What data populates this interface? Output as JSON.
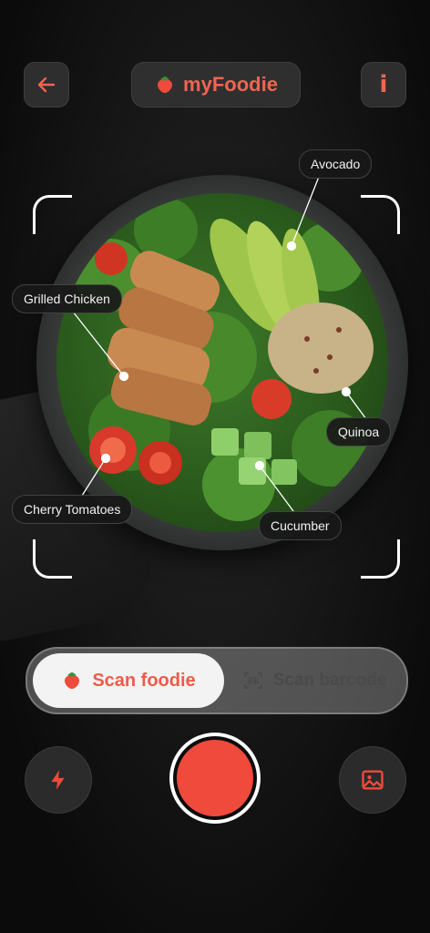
{
  "app": {
    "name": "myFoodie"
  },
  "header": {
    "back_icon": "arrow-left-icon",
    "logo_icon": "strawberry-icon",
    "info_label": "i"
  },
  "detections": [
    {
      "label": "Avocado"
    },
    {
      "label": "Grilled Chicken"
    },
    {
      "label": "Quinoa"
    },
    {
      "label": "Cherry Tomatoes"
    },
    {
      "label": "Cucumber"
    }
  ],
  "scan_modes": {
    "active": {
      "label": "Scan foodie",
      "icon": "strawberry-icon"
    },
    "other": {
      "label": "Scan barcode",
      "icon": "barcode-icon"
    }
  },
  "controls": {
    "flash_icon": "lightning-icon",
    "shutter": "capture-button",
    "gallery_icon": "image-icon"
  },
  "colors": {
    "accent": "#f06552",
    "background": "#0c0c0c",
    "shutter": "#ef4a3c"
  }
}
